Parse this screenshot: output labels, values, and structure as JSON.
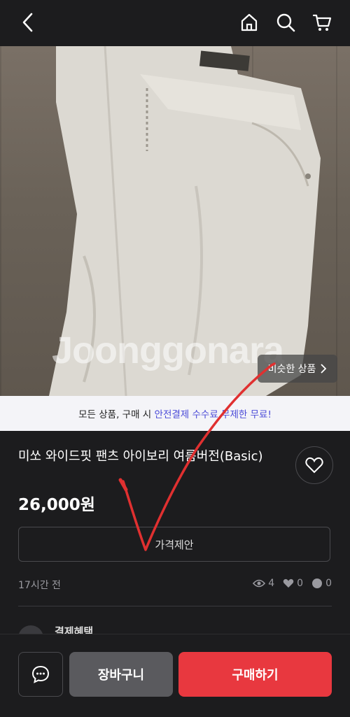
{
  "header": {
    "back_icon": "chevron-left-icon",
    "home_icon": "home-icon",
    "search_icon": "search-icon",
    "cart_icon": "cart-icon"
  },
  "photo": {
    "watermark": "Joonggonara",
    "similar_label": "비슷한 상품",
    "similar_icon": "chevron-right-icon"
  },
  "promo": {
    "text_before": "모든 상품, 구매 시 ",
    "highlight": "안전결제 수수료 무제한 무료!"
  },
  "product": {
    "title": "미쏘 와이드핏 팬츠 아이보리 여름버전(Basic)",
    "price": "26,000원",
    "offer_label": "가격제안",
    "posted_time": "17시간 전",
    "views": "4",
    "likes": "0",
    "chats": "0"
  },
  "benefit": {
    "label": "결제혜택"
  },
  "actions": {
    "chat_icon": "chat-bubble-icon",
    "cart_label": "장바구니",
    "buy_label": "구매하기"
  },
  "colors": {
    "background": "#1c1c1e",
    "accent_red": "#e8383f",
    "promo_highlight": "#4b4bd8",
    "annotation_red": "#e03030"
  }
}
